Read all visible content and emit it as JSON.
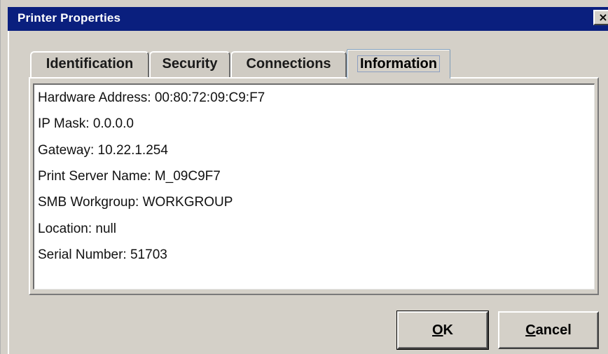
{
  "window": {
    "title": "Printer Properties",
    "close_glyph": "×"
  },
  "tabs": [
    {
      "label": "Identification",
      "active": false
    },
    {
      "label": "Security",
      "active": false
    },
    {
      "label": "Connections",
      "active": false
    },
    {
      "label": "Information",
      "active": true
    }
  ],
  "information": {
    "lines": [
      "Hardware Address: 00:80:72:09:C9:F7",
      "IP Mask: 0.0.0.0",
      "Gateway: 10.22.1.254",
      "Print Server Name: M_09C9F7",
      "SMB Workgroup: WORKGROUP",
      "Location: null",
      "Serial Number: 51703"
    ]
  },
  "buttons": {
    "ok": {
      "mnemonic": "O",
      "rest": "K"
    },
    "cancel": {
      "mnemonic": "C",
      "rest": "ancel"
    }
  },
  "colors": {
    "titlebar": "#0a1f7e",
    "dialog_bg": "#d4d0c8",
    "active_tab_border": "#7f9db9"
  },
  "icons": {
    "close": "close-icon"
  }
}
